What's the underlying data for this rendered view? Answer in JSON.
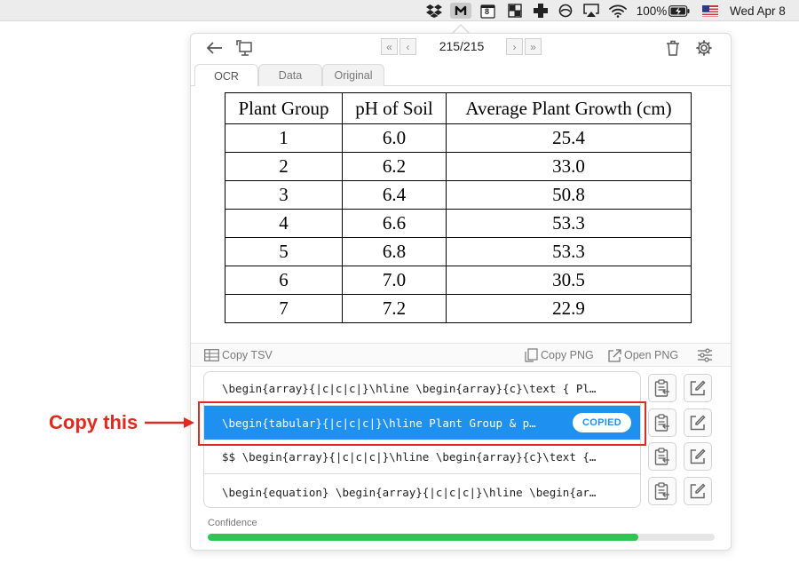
{
  "menubar": {
    "battery": "100%",
    "datetime": "Wed Apr 8",
    "calendar_day": "8",
    "icons": [
      "dropbox-icon",
      "mathpix-icon",
      "calendar-icon",
      "window-grid-icon",
      "plus-cross-icon",
      "circle-slash-icon",
      "airplay-icon",
      "wifi-icon",
      "battery-icon",
      "us-flag-icon"
    ]
  },
  "toolbar": {
    "counter": "215/215",
    "first": "«",
    "prev": "‹",
    "next": "›",
    "last": "»"
  },
  "tabs": [
    {
      "label": "OCR",
      "active": true
    },
    {
      "label": "Data",
      "active": false
    },
    {
      "label": "Original",
      "active": false
    }
  ],
  "table": {
    "headers": [
      "Plant Group",
      "pH of Soil",
      "Average Plant Growth (cm)"
    ],
    "rows": [
      [
        "1",
        "6.0",
        "25.4"
      ],
      [
        "2",
        "6.2",
        "33.0"
      ],
      [
        "3",
        "6.4",
        "50.8"
      ],
      [
        "4",
        "6.6",
        "53.3"
      ],
      [
        "5",
        "6.8",
        "53.3"
      ],
      [
        "6",
        "7.0",
        "30.5"
      ],
      [
        "7",
        "7.2",
        "22.9"
      ]
    ]
  },
  "actions": {
    "copy_tsv": "Copy TSV",
    "copy_png": "Copy PNG",
    "open_png": "Open PNG"
  },
  "results": [
    {
      "text": "\\begin{array}{|c|c|c|}\\hline \\begin{array}{c}\\text { Pl…",
      "selected": false
    },
    {
      "text": "\\begin{tabular}{|c|c|c|}\\hline Plant Group & p…",
      "selected": true,
      "badge": "COPIED"
    },
    {
      "text": "$$ \\begin{array}{|c|c|c|}\\hline \\begin{array}{c}\\text {…",
      "selected": false
    },
    {
      "text": "\\begin{equation} \\begin{array}{|c|c|c|}\\hline \\begin{ar…",
      "selected": false
    }
  ],
  "confidence": {
    "label": "Confidence",
    "value": 0.85
  },
  "annotation": {
    "text": "Copy this"
  },
  "colors": {
    "selected_row": "#1e90f0",
    "confidence": "#2ec553",
    "annotation": "#e02a1f"
  }
}
